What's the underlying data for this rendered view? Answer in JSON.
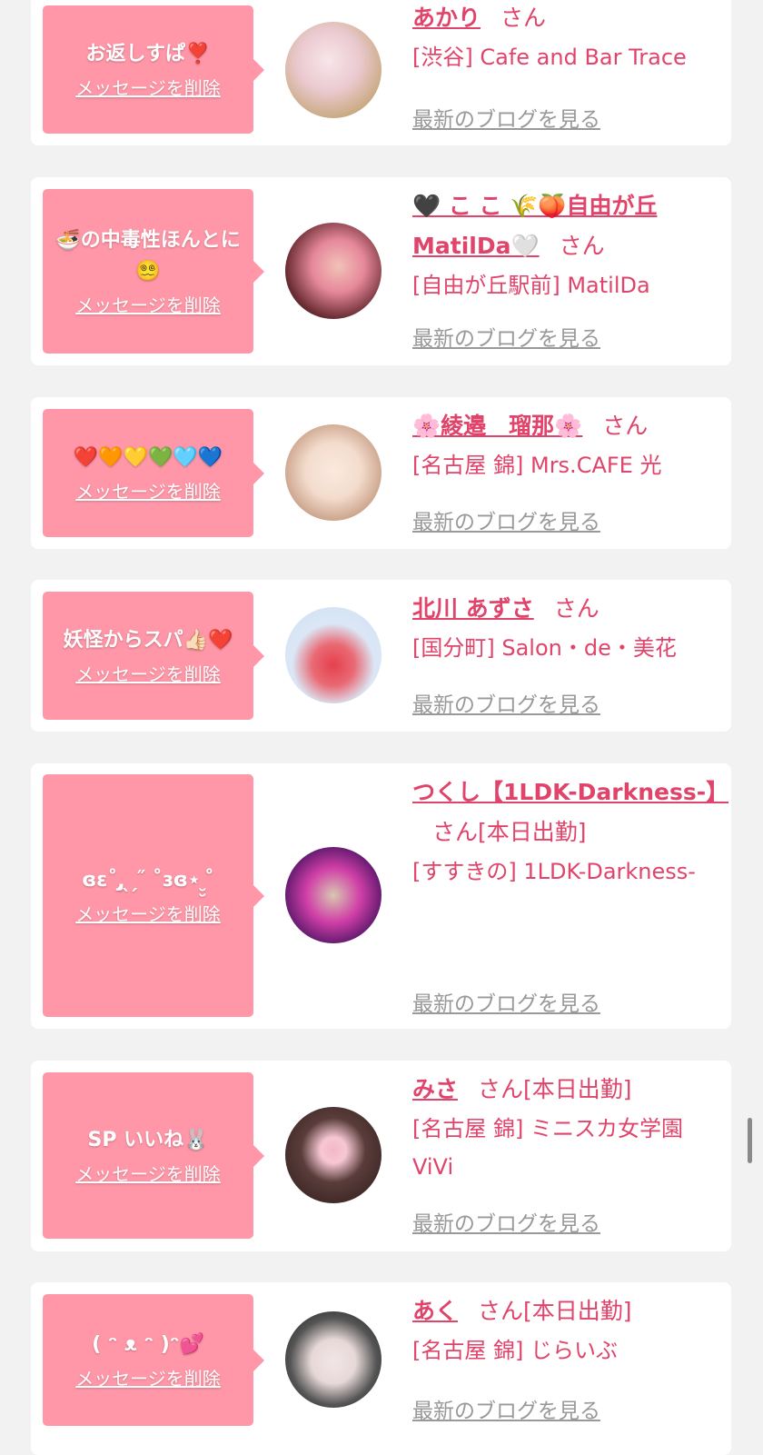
{
  "messages": [
    {
      "bubble": "お返しすぱ❣️",
      "delete_label": "メッセージを削除",
      "name": "あかり",
      "san": "さん",
      "shop": "[渋谷] Cafe and Bar Trace",
      "blog_label": "最新のブログを見る",
      "avatar_colors": [
        "#f7e6ea",
        "#c9a97f"
      ]
    },
    {
      "bubble": "🍜の中毒性ほんとに😵‍💫",
      "delete_label": "メッセージを削除",
      "name": "🖤 こ こ 🌾🍑自由が丘MatilDa🤍",
      "san": "さん",
      "shop": "[自由が丘駅前] MatilDa",
      "blog_label": "最新のブログを見る",
      "avatar_colors": [
        "#1e1e22",
        "#e6889a"
      ]
    },
    {
      "bubble": "❤️🧡💛💚🩵💙",
      "delete_label": "メッセージを削除",
      "name": "🌸綾邉　瑠那🌸",
      "san": "さん",
      "shop": "[名古屋 錦] Mrs.CAFE 光",
      "blog_label": "最新のブログを見る",
      "avatar_colors": [
        "#f3dccd",
        "#a37a66"
      ]
    },
    {
      "bubble": "妖怪からスパ👍🏻❤️",
      "delete_label": "メッセージを削除",
      "name": "北川 あずさ",
      "san": "さん",
      "shop": "[国分町] Salon・de・美花",
      "blog_label": "最新のブログを見る",
      "avatar_colors": [
        "#dbe7f6",
        "#e5404d"
      ]
    },
    {
      "bubble": "ɞɛ˚ ̨̡ ̖ ̗ ̋ ˚ɜɞ⋆ ̮̮ ̊",
      "delete_label": "メッセージを削除",
      "name": "つくし【1LDK-Darkness-】",
      "san": "さん",
      "extra": "[本日出勤]",
      "shop": "[すすきの] 1LDK-Darkness-",
      "blog_label": "最新のブログを見る",
      "avatar_colors": [
        "#3a1140",
        "#d03fa7"
      ]
    },
    {
      "bubble": "SP いいね🐰",
      "delete_label": "メッセージを削除",
      "name": "みさ",
      "san": "さん",
      "extra": "[本日出勤]",
      "shop": "[名古屋 錦] ミニスカ女学園ViVi",
      "blog_label": "最新のブログを見る",
      "avatar_colors": [
        "#2a1a1a",
        "#f4b7c9"
      ]
    },
    {
      "bubble": "( ᵔ ᴥ ᵔ )ᵔ💕",
      "delete_label": "メッセージを削除",
      "name": "あく",
      "san": "さん",
      "extra": "[本日出勤]",
      "shop": "[名古屋 錦] じらいぶ",
      "blog_label": "最新のブログを見る",
      "avatar_colors": [
        "#1a1a1a",
        "#e7d8d8"
      ]
    }
  ]
}
